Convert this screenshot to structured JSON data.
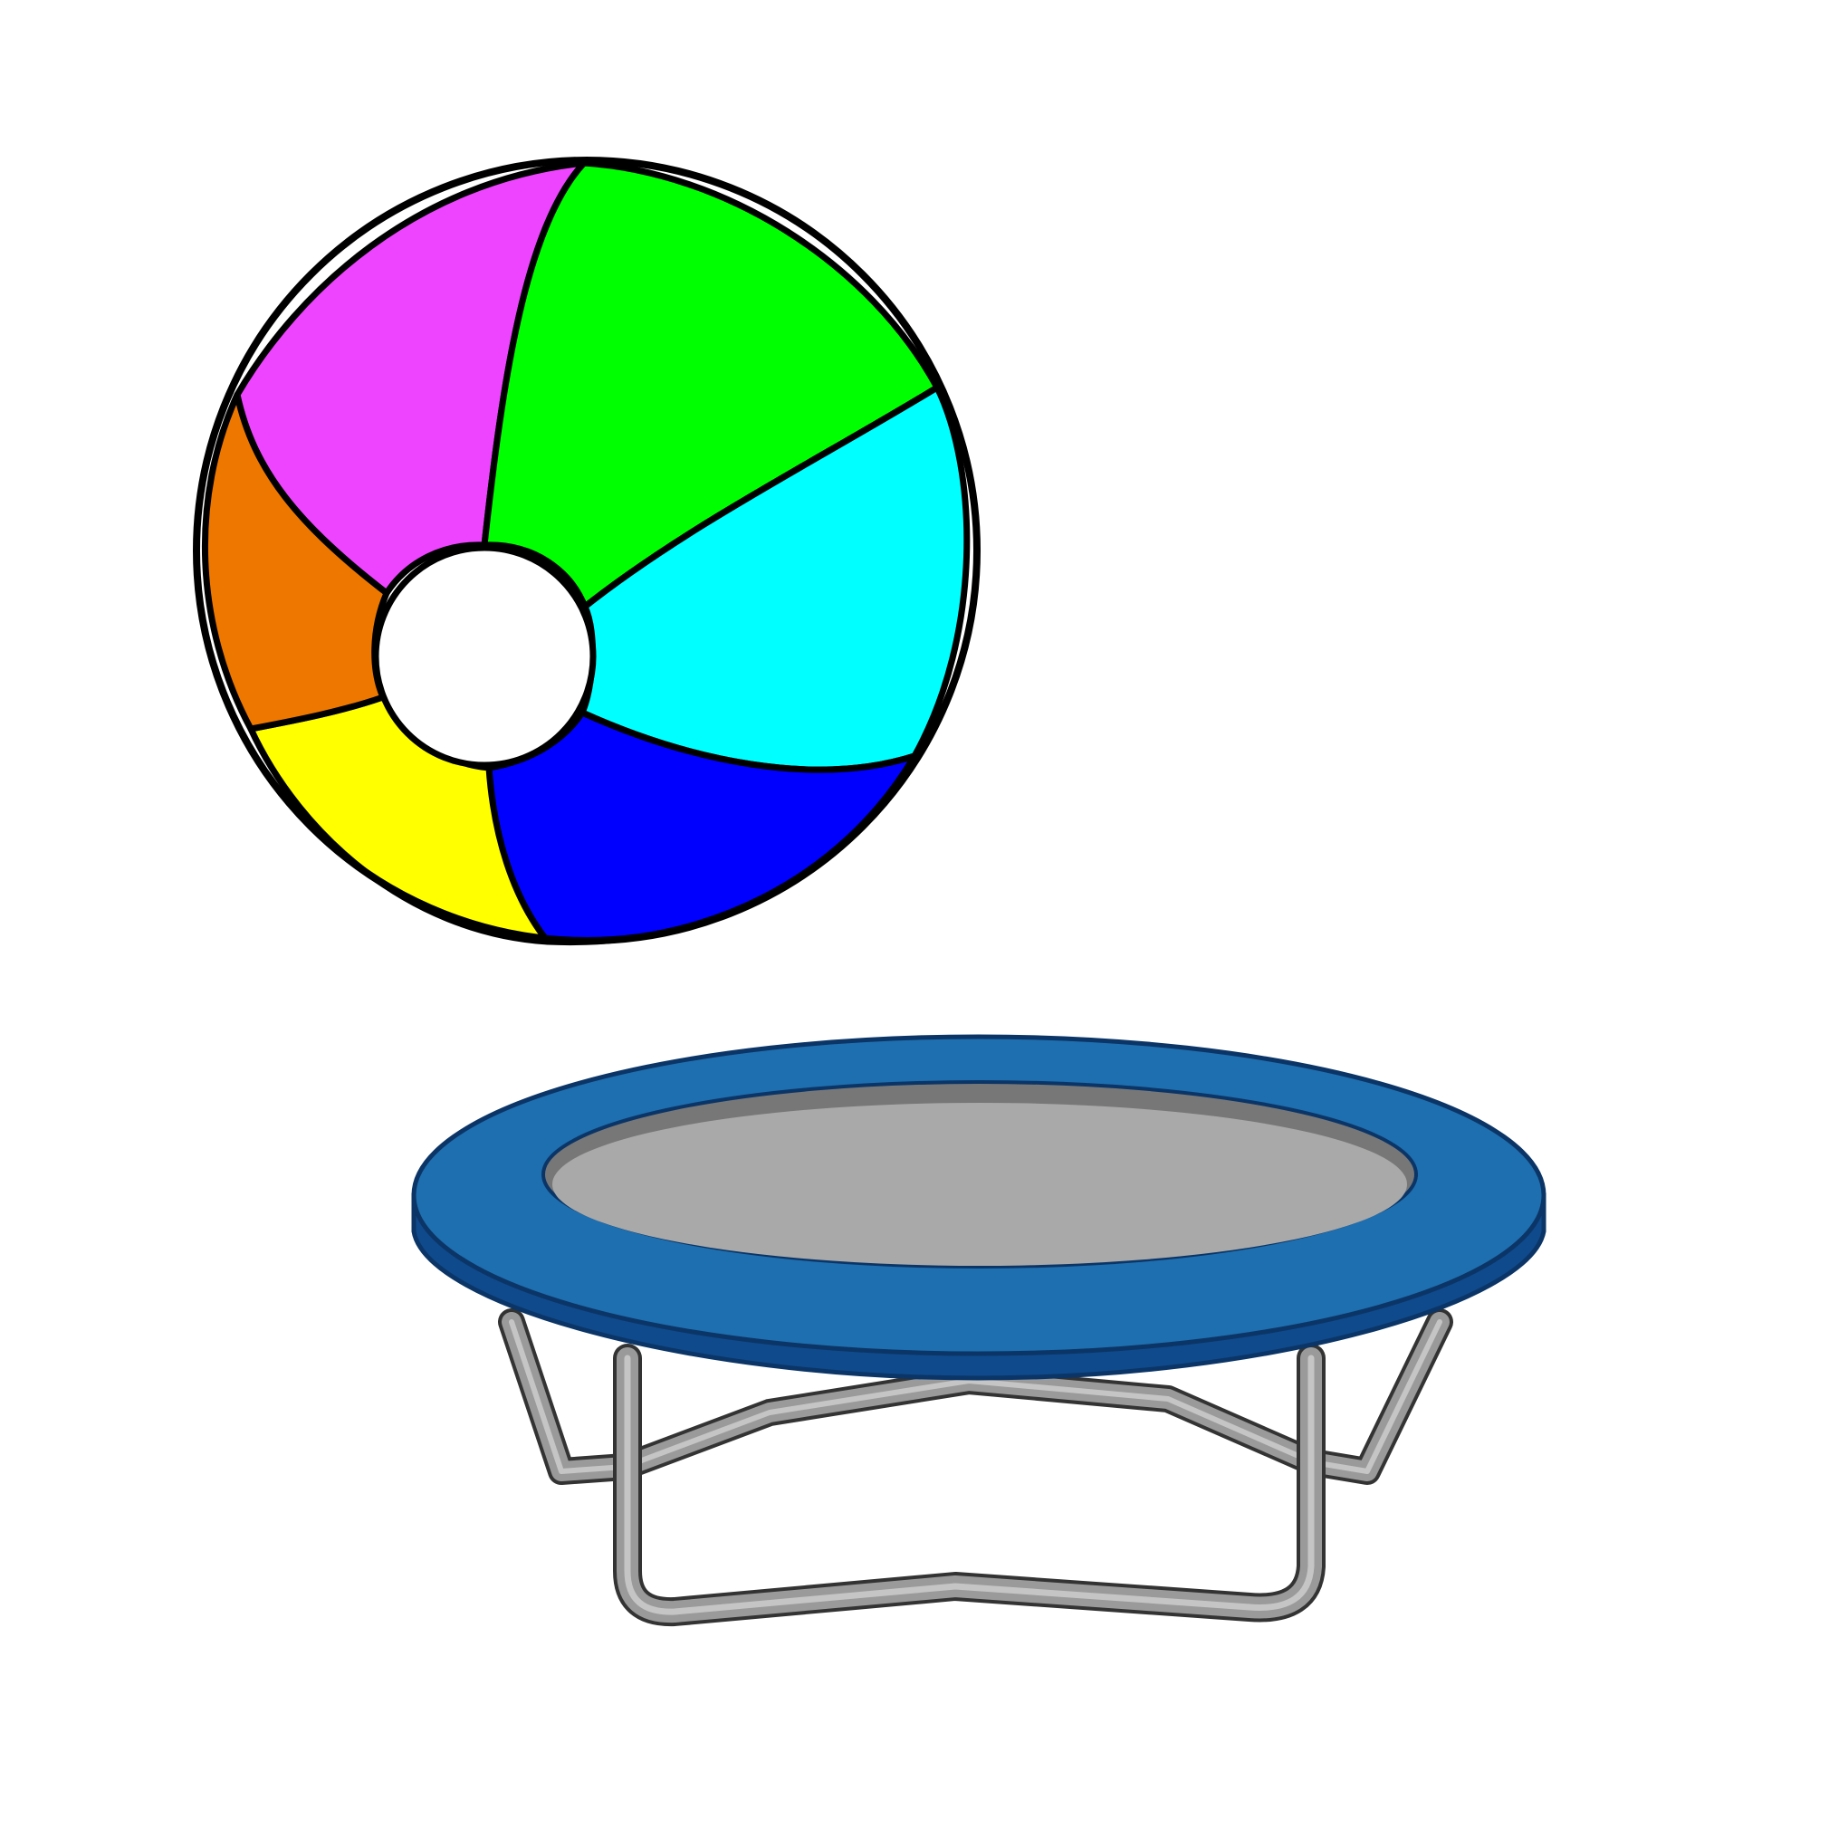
{
  "scene": {
    "background": "#ffffff",
    "objects": [
      {
        "name": "beach-ball",
        "panel_colors": {
          "magenta": "#ee44ff",
          "green": "#00ff00",
          "cyan": "#00ffff",
          "blue": "#0000ff",
          "yellow": "#ffff00",
          "orange": "#ee7700",
          "center": "#ffffff"
        },
        "outline": "#000000"
      },
      {
        "name": "trampoline",
        "colors": {
          "pad": "#1e6fb0",
          "pad_dark": "#0f4a8c",
          "mat": "#a9a9a9",
          "mat_rim": "#777777",
          "frame": "#9a9a9a",
          "frame_highlight": "#cfcfcf",
          "outline": "#333333"
        }
      }
    ]
  }
}
